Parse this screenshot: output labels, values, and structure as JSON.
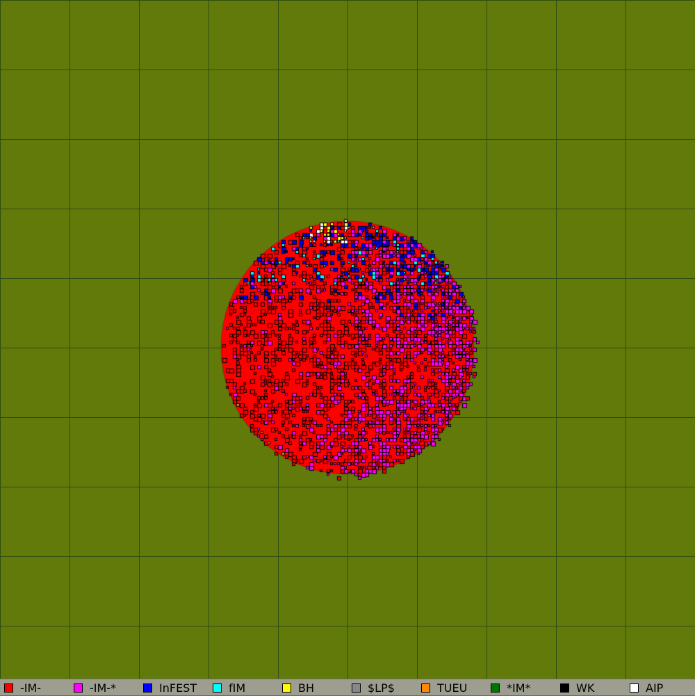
{
  "map": {
    "background_color": "#617a0a",
    "grid_color": "#2f4d12",
    "grid_cells": 10
  },
  "legend": [
    {
      "label": "-IM-",
      "color": "#ff0000",
      "icon": "red-square-icon"
    },
    {
      "label": "-IM-*",
      "color": "#ff00ff",
      "icon": "magenta-square-icon"
    },
    {
      "label": "InFEST",
      "color": "#0000ff",
      "icon": "blue-square-icon"
    },
    {
      "label": "fIM",
      "color": "#00ffff",
      "icon": "cyan-square-icon"
    },
    {
      "label": "BH",
      "color": "#ffff00",
      "icon": "yellow-square-icon"
    },
    {
      "label": "$LP$",
      "color": "#888888",
      "icon": "gray-square-icon"
    },
    {
      "label": "TUEU",
      "color": "#ff8800",
      "icon": "orange-square-icon"
    },
    {
      "label": "*IM*",
      "color": "#007700",
      "icon": "green-square-icon"
    },
    {
      "label": "WK",
      "color": "#000000",
      "icon": "black-square-icon"
    },
    {
      "label": "AIP",
      "color": "#ffffff",
      "icon": "white-square-icon"
    }
  ]
}
